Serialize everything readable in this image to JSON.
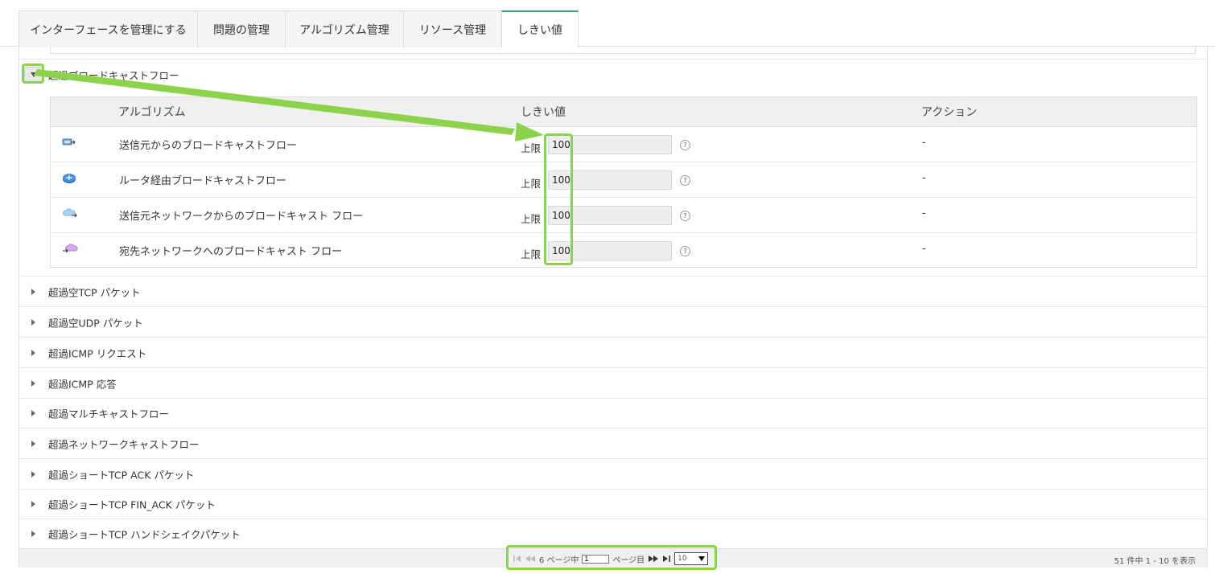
{
  "tabs": [
    {
      "label": "インターフェースを管理にする"
    },
    {
      "label": "問題の管理"
    },
    {
      "label": "アルゴリズム管理"
    },
    {
      "label": "リソース管理"
    },
    {
      "label": "しきい値",
      "active": true
    }
  ],
  "expanded_group": {
    "title": "超過ブロードキャストフロー",
    "table": {
      "headers": {
        "algorithm": "アルゴリズム",
        "threshold": "しきい値",
        "action": "アクション"
      },
      "rows": [
        {
          "icon": "network-source-icon",
          "name": "送信元からのブロードキャストフロー",
          "limit_label": "上限",
          "value": "100",
          "help": "?",
          "action": "-"
        },
        {
          "icon": "router-icon",
          "name": "ルータ経由ブロードキャストフロー",
          "limit_label": "上限",
          "value": "100",
          "help": "?",
          "action": "-"
        },
        {
          "icon": "cloud-out-icon",
          "name": "送信元ネットワークからのブロードキャスト フロー",
          "limit_label": "上限",
          "value": "100",
          "help": "?",
          "action": "-"
        },
        {
          "icon": "cloud-in-icon",
          "name": "宛先ネットワークへのブロードキャスト フロー",
          "limit_label": "上限",
          "value": "100",
          "help": "?",
          "action": "-"
        }
      ]
    }
  },
  "groups": [
    "超過空TCP パケット",
    "超過空UDP パケット",
    "超過ICMP リクエスト",
    "超過ICMP 応答",
    "超過マルチキャストフロー",
    "超過ネットワークキャストフロー",
    "超過ショートTCP ACK パケット",
    "超過ショートTCP FIN_ACK パケット",
    "超過ショートTCP ハンドシェイクパケット"
  ],
  "pager": {
    "of_pages": "6 ページ中",
    "page_value": "1",
    "page_suffix": "ページ目",
    "page_size": "10",
    "summary": "51 件中 1 - 10 を表示"
  },
  "colors": {
    "highlight": "#8cd24a",
    "active_tab": "#3aa36e"
  }
}
